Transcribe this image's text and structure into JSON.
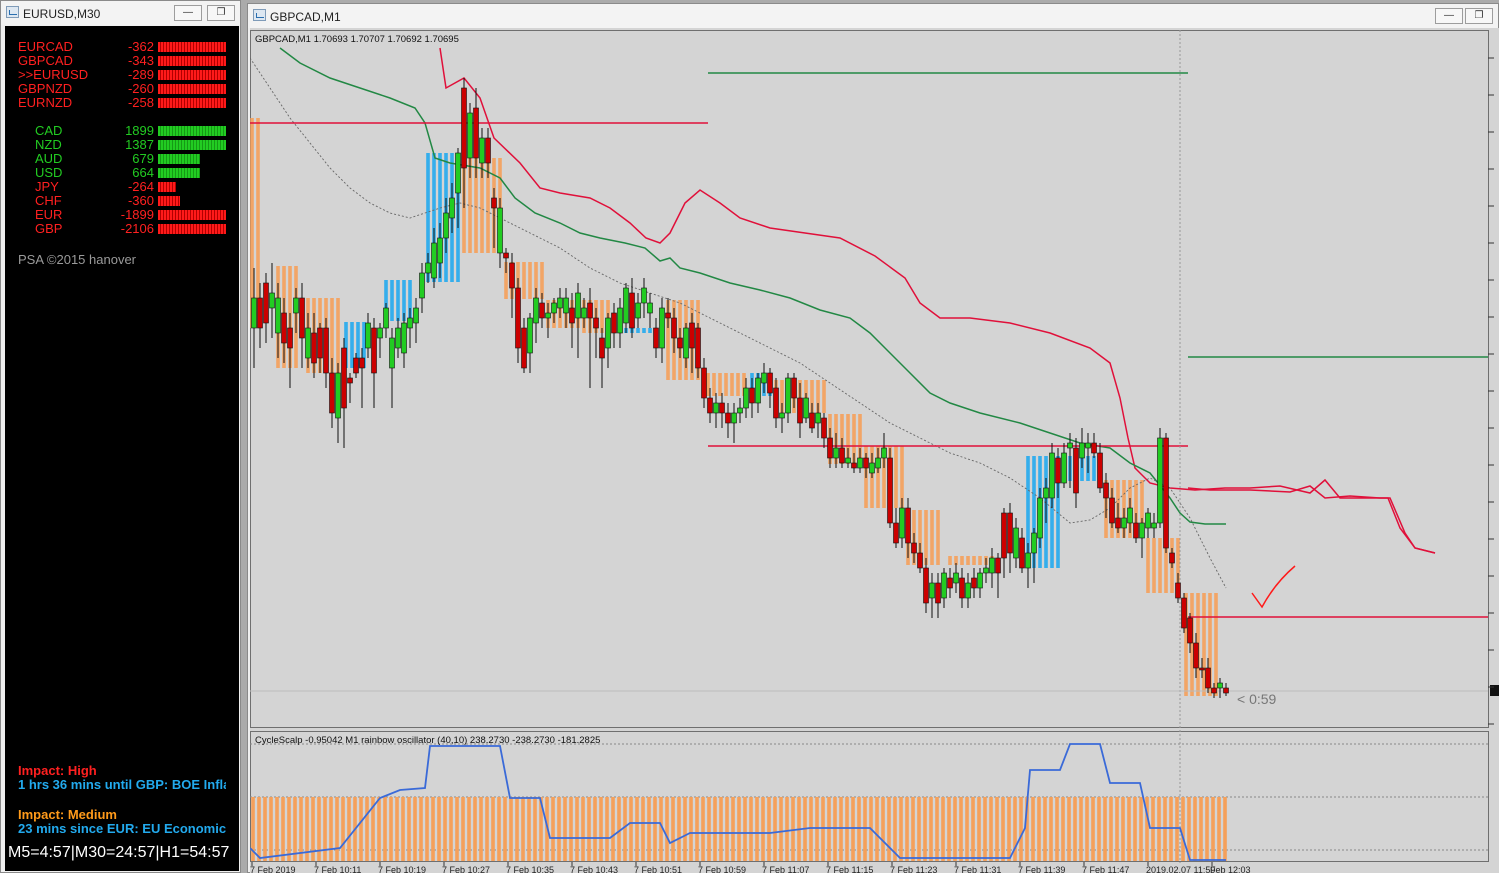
{
  "left_window": {
    "title": "EURUSD,M30",
    "pairs": [
      {
        "name": "EURCAD",
        "value": "-362",
        "bar": 1.0,
        "color": "#ff1a1a",
        "prefix": ""
      },
      {
        "name": "GBPCAD",
        "value": "-343",
        "bar": 1.0,
        "color": "#ff1a1a",
        "prefix": ""
      },
      {
        "name": "EURUSD",
        "value": "-289",
        "bar": 1.0,
        "color": "#ff1a1a",
        "prefix": ">>"
      },
      {
        "name": "GBPNZD",
        "value": "-260",
        "bar": 1.0,
        "color": "#ff1a1a",
        "prefix": ""
      },
      {
        "name": "EURNZD",
        "value": "-258",
        "bar": 1.0,
        "color": "#ff1a1a",
        "prefix": ""
      }
    ],
    "currencies": [
      {
        "name": "CAD",
        "value": "1899",
        "bar": 1.0,
        "color": "#22cc22"
      },
      {
        "name": "NZD",
        "value": "1387",
        "bar": 1.0,
        "color": "#22cc22"
      },
      {
        "name": "AUD",
        "value": "679",
        "bar": 0.62,
        "color": "#22cc22"
      },
      {
        "name": "USD",
        "value": "664",
        "bar": 0.62,
        "color": "#22cc22"
      },
      {
        "name": "JPY",
        "value": "-264",
        "bar": 0.27,
        "color": "#ff1a1a"
      },
      {
        "name": "CHF",
        "value": "-360",
        "bar": 0.33,
        "color": "#ff1a1a"
      },
      {
        "name": "EUR",
        "value": "-1899",
        "bar": 1.0,
        "color": "#ff1a1a"
      },
      {
        "name": "GBP",
        "value": "-2106",
        "bar": 1.0,
        "color": "#ff1a1a"
      }
    ],
    "credit": "PSA ©2015 hanover",
    "news": {
      "high_label": "Impact: High",
      "high_text": "1 hrs 36 mins until GBP: BOE Infla",
      "medium_label": "Impact: Medium",
      "medium_text": "23 mins since EUR: EU Economic"
    },
    "timers": "M5=4:57|M30=24:57|H1=54:57"
  },
  "main_window": {
    "title": "GBPCAD,M1",
    "chart_header": "GBPCAD,M1  1.70693 1.70707 1.70692 1.70695",
    "countdown": "< 0:59",
    "oscillator_header": "CycleScalp -0.95042  M1 rainbow oscillator (40,10) 238.2730 -238.2730 -181.2825",
    "time_labels": [
      "7 Feb 2019",
      "7 Feb 10:11",
      "7 Feb 10:19",
      "7 Feb 10:27",
      "7 Feb 10:35",
      "7 Feb 10:43",
      "7 Feb 10:51",
      "7 Feb 10:59",
      "7 Feb 11:07",
      "7 Feb 11:15",
      "7 Feb 11:23",
      "7 Feb 11:31",
      "7 Feb 11:39",
      "7 Feb 11:47",
      "2019.02.07 11:59",
      "Feb 12:03"
    ],
    "colors": {
      "bull": "#22cc22",
      "bear": "#cc0000",
      "orange_band": "#f5a05a",
      "blue_band": "#22aaee",
      "red_line": "#e0103a",
      "green_line": "#228844",
      "osc_line": "#3a6ad8"
    }
  }
}
